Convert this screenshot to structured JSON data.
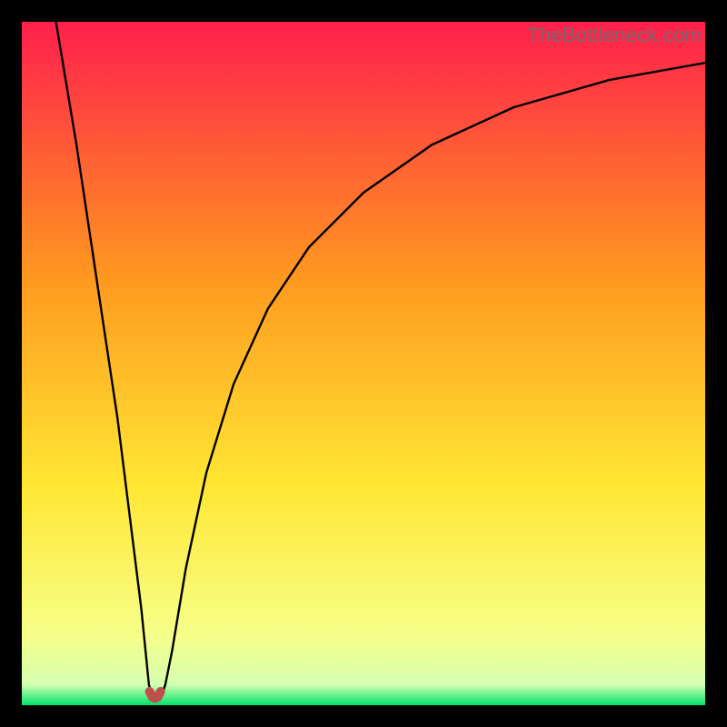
{
  "watermark": "TheBottleneck.com",
  "chart_data": {
    "type": "line",
    "title": "",
    "xlabel": "",
    "ylabel": "",
    "xlim": [
      0,
      100
    ],
    "ylim": [
      0,
      100
    ],
    "grid": false,
    "background_gradient": {
      "top": "#ff1f4c",
      "mid_upper": "#ff9a1f",
      "mid": "#ffe733",
      "mid_lower": "#f6ff8a",
      "bottom": "#00e36b"
    },
    "series": [
      {
        "name": "curve",
        "color": "#000000",
        "x": [
          5,
          8,
          11,
          14,
          16,
          17.5,
          18.2,
          18.6,
          19,
          19.5,
          20,
          20.5,
          21,
          22,
          24,
          27,
          31,
          36,
          42,
          50,
          60,
          72,
          86,
          100
        ],
        "y": [
          100,
          82,
          62,
          42,
          26,
          14,
          7,
          3,
          1.5,
          1.2,
          1.2,
          1.5,
          3,
          8,
          20,
          34,
          47,
          58,
          67,
          75,
          82,
          87.5,
          91.5,
          94
        ]
      }
    ],
    "markers": [
      {
        "name": "dip-segment",
        "color": "#c0504d",
        "x": [
          18.7,
          19.1,
          19.5,
          19.9,
          20.3
        ],
        "y": [
          2.0,
          1.2,
          1.0,
          1.2,
          2.0
        ]
      }
    ]
  }
}
